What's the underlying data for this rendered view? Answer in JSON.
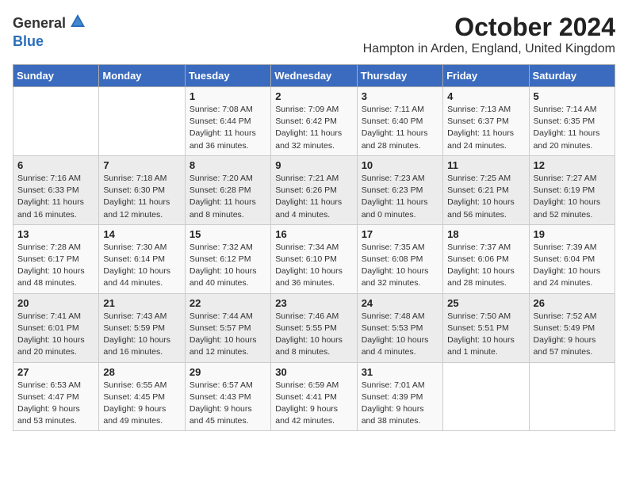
{
  "header": {
    "logo_general": "General",
    "logo_blue": "Blue",
    "title": "October 2024",
    "location": "Hampton in Arden, England, United Kingdom"
  },
  "weekdays": [
    "Sunday",
    "Monday",
    "Tuesday",
    "Wednesday",
    "Thursday",
    "Friday",
    "Saturday"
  ],
  "weeks": [
    [
      {
        "day": "",
        "info": ""
      },
      {
        "day": "",
        "info": ""
      },
      {
        "day": "1",
        "info": "Sunrise: 7:08 AM\nSunset: 6:44 PM\nDaylight: 11 hours and 36 minutes."
      },
      {
        "day": "2",
        "info": "Sunrise: 7:09 AM\nSunset: 6:42 PM\nDaylight: 11 hours and 32 minutes."
      },
      {
        "day": "3",
        "info": "Sunrise: 7:11 AM\nSunset: 6:40 PM\nDaylight: 11 hours and 28 minutes."
      },
      {
        "day": "4",
        "info": "Sunrise: 7:13 AM\nSunset: 6:37 PM\nDaylight: 11 hours and 24 minutes."
      },
      {
        "day": "5",
        "info": "Sunrise: 7:14 AM\nSunset: 6:35 PM\nDaylight: 11 hours and 20 minutes."
      }
    ],
    [
      {
        "day": "6",
        "info": "Sunrise: 7:16 AM\nSunset: 6:33 PM\nDaylight: 11 hours and 16 minutes."
      },
      {
        "day": "7",
        "info": "Sunrise: 7:18 AM\nSunset: 6:30 PM\nDaylight: 11 hours and 12 minutes."
      },
      {
        "day": "8",
        "info": "Sunrise: 7:20 AM\nSunset: 6:28 PM\nDaylight: 11 hours and 8 minutes."
      },
      {
        "day": "9",
        "info": "Sunrise: 7:21 AM\nSunset: 6:26 PM\nDaylight: 11 hours and 4 minutes."
      },
      {
        "day": "10",
        "info": "Sunrise: 7:23 AM\nSunset: 6:23 PM\nDaylight: 11 hours and 0 minutes."
      },
      {
        "day": "11",
        "info": "Sunrise: 7:25 AM\nSunset: 6:21 PM\nDaylight: 10 hours and 56 minutes."
      },
      {
        "day": "12",
        "info": "Sunrise: 7:27 AM\nSunset: 6:19 PM\nDaylight: 10 hours and 52 minutes."
      }
    ],
    [
      {
        "day": "13",
        "info": "Sunrise: 7:28 AM\nSunset: 6:17 PM\nDaylight: 10 hours and 48 minutes."
      },
      {
        "day": "14",
        "info": "Sunrise: 7:30 AM\nSunset: 6:14 PM\nDaylight: 10 hours and 44 minutes."
      },
      {
        "day": "15",
        "info": "Sunrise: 7:32 AM\nSunset: 6:12 PM\nDaylight: 10 hours and 40 minutes."
      },
      {
        "day": "16",
        "info": "Sunrise: 7:34 AM\nSunset: 6:10 PM\nDaylight: 10 hours and 36 minutes."
      },
      {
        "day": "17",
        "info": "Sunrise: 7:35 AM\nSunset: 6:08 PM\nDaylight: 10 hours and 32 minutes."
      },
      {
        "day": "18",
        "info": "Sunrise: 7:37 AM\nSunset: 6:06 PM\nDaylight: 10 hours and 28 minutes."
      },
      {
        "day": "19",
        "info": "Sunrise: 7:39 AM\nSunset: 6:04 PM\nDaylight: 10 hours and 24 minutes."
      }
    ],
    [
      {
        "day": "20",
        "info": "Sunrise: 7:41 AM\nSunset: 6:01 PM\nDaylight: 10 hours and 20 minutes."
      },
      {
        "day": "21",
        "info": "Sunrise: 7:43 AM\nSunset: 5:59 PM\nDaylight: 10 hours and 16 minutes."
      },
      {
        "day": "22",
        "info": "Sunrise: 7:44 AM\nSunset: 5:57 PM\nDaylight: 10 hours and 12 minutes."
      },
      {
        "day": "23",
        "info": "Sunrise: 7:46 AM\nSunset: 5:55 PM\nDaylight: 10 hours and 8 minutes."
      },
      {
        "day": "24",
        "info": "Sunrise: 7:48 AM\nSunset: 5:53 PM\nDaylight: 10 hours and 4 minutes."
      },
      {
        "day": "25",
        "info": "Sunrise: 7:50 AM\nSunset: 5:51 PM\nDaylight: 10 hours and 1 minute."
      },
      {
        "day": "26",
        "info": "Sunrise: 7:52 AM\nSunset: 5:49 PM\nDaylight: 9 hours and 57 minutes."
      }
    ],
    [
      {
        "day": "27",
        "info": "Sunrise: 6:53 AM\nSunset: 4:47 PM\nDaylight: 9 hours and 53 minutes."
      },
      {
        "day": "28",
        "info": "Sunrise: 6:55 AM\nSunset: 4:45 PM\nDaylight: 9 hours and 49 minutes."
      },
      {
        "day": "29",
        "info": "Sunrise: 6:57 AM\nSunset: 4:43 PM\nDaylight: 9 hours and 45 minutes."
      },
      {
        "day": "30",
        "info": "Sunrise: 6:59 AM\nSunset: 4:41 PM\nDaylight: 9 hours and 42 minutes."
      },
      {
        "day": "31",
        "info": "Sunrise: 7:01 AM\nSunset: 4:39 PM\nDaylight: 9 hours and 38 minutes."
      },
      {
        "day": "",
        "info": ""
      },
      {
        "day": "",
        "info": ""
      }
    ]
  ]
}
